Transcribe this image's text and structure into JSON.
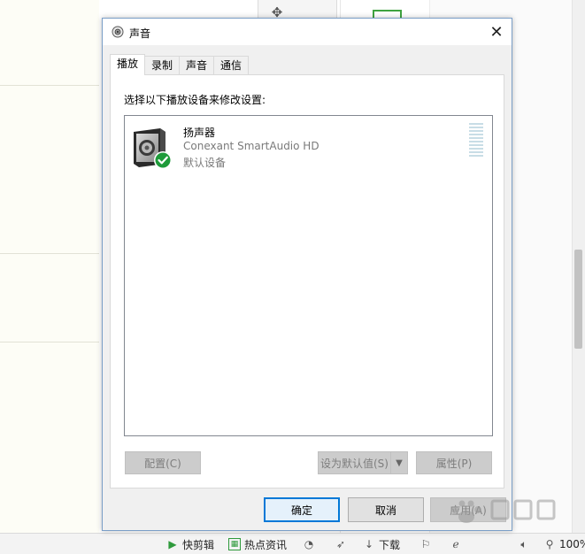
{
  "dialog": {
    "title": "声音",
    "tabs": [
      {
        "label": "播放",
        "active": true
      },
      {
        "label": "录制",
        "active": false
      },
      {
        "label": "声音",
        "active": false
      },
      {
        "label": "通信",
        "active": false
      }
    ],
    "instructions": "选择以下播放设备来修改设置:",
    "devices": [
      {
        "name": "扬声器",
        "description": "Conexant SmartAudio HD",
        "status": "默认设备",
        "icon": "speaker-icon",
        "badge": "check-icon"
      }
    ],
    "buttons": {
      "configure": "配置(C)",
      "set_default": "设为默认值(S)",
      "properties": "属性(P)",
      "ok": "确定",
      "cancel": "取消",
      "apply": "应用(A)"
    },
    "close_glyph": "✕"
  },
  "statusbar": {
    "items": [
      {
        "label": "快剪辑",
        "icon": "play-icon"
      },
      {
        "label": "热点资讯",
        "icon": "news-icon"
      },
      {
        "label": "下载",
        "icon": "download-icon"
      }
    ],
    "zoom": "100%"
  },
  "colors": {
    "accent": "#0078d7",
    "check": "#1e9b3a",
    "dialog_bg": "#f0f0f0"
  }
}
